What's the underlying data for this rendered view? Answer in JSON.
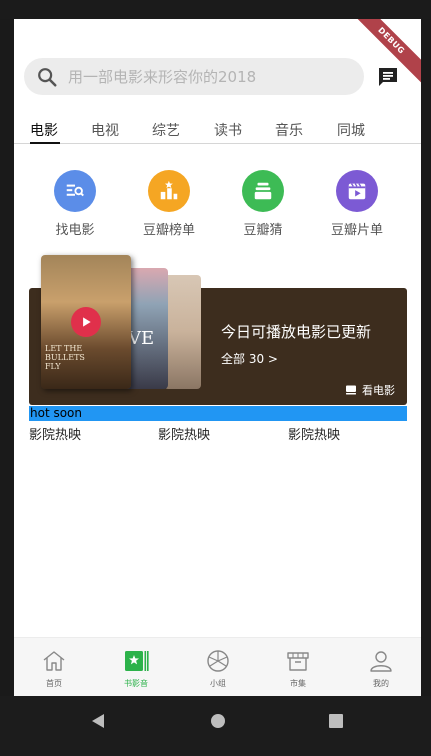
{
  "debug_banner": "DEBUG",
  "search": {
    "placeholder": "用一部电影来形容你的2018"
  },
  "tabs": [
    {
      "label": "电影",
      "active": true
    },
    {
      "label": "电视"
    },
    {
      "label": "综艺"
    },
    {
      "label": "读书"
    },
    {
      "label": "音乐"
    },
    {
      "label": "同城"
    }
  ],
  "categories": [
    {
      "label": "找电影",
      "icon": "find-movie-icon",
      "color": "#5b8de8"
    },
    {
      "label": "豆瓣榜单",
      "icon": "ranking-icon",
      "color": "#f5a623"
    },
    {
      "label": "豆瓣猜",
      "icon": "guess-icon",
      "color": "#3dbb55"
    },
    {
      "label": "豆瓣片单",
      "icon": "movie-list-icon",
      "color": "#7c5ad4"
    }
  ],
  "banner": {
    "title": "今日可播放电影已更新",
    "subtitle": "全部 30 >",
    "link": "看电影",
    "poster1_text": "LET THE BULLETS FLY",
    "poster2_text": "VE"
  },
  "hot": {
    "label": "hot soon",
    "cinema_items": [
      "影院热映",
      "影院热映",
      "影院热映"
    ]
  },
  "bottom_nav": [
    {
      "label": "首页",
      "icon": "home-icon"
    },
    {
      "label": "书影音",
      "icon": "media-icon",
      "active": true
    },
    {
      "label": "小组",
      "icon": "group-icon"
    },
    {
      "label": "市集",
      "icon": "market-icon"
    },
    {
      "label": "我的",
      "icon": "profile-icon"
    }
  ],
  "colors": {
    "accent_green": "#2cb24a",
    "hot_bar": "#2196f3",
    "banner_bg": "#3d2d1e",
    "play_button": "#e0304b"
  }
}
